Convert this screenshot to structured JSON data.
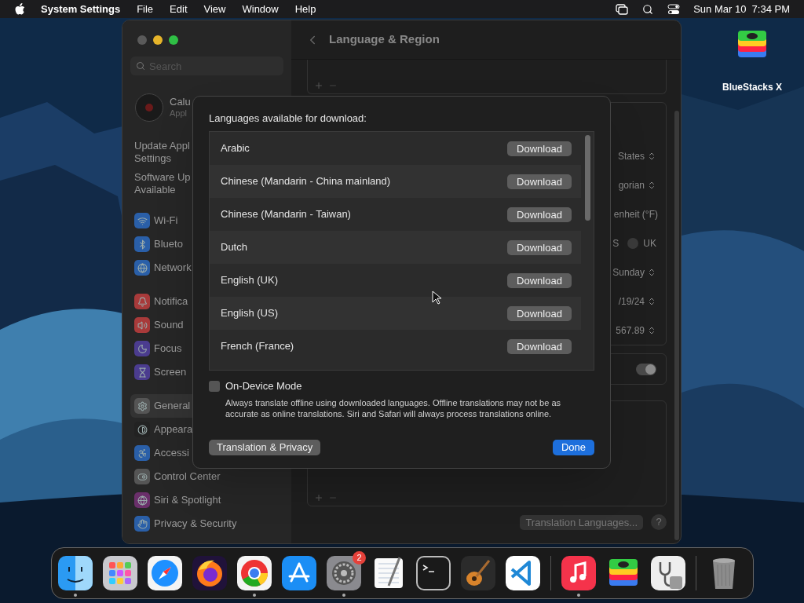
{
  "menu_bar": {
    "app": "System Settings",
    "menus": [
      "File",
      "Edit",
      "View",
      "Window",
      "Help"
    ],
    "clock": "Sun Mar 10  7:34 PM"
  },
  "desktop_icons": [
    {
      "label": "BlueStacks X"
    }
  ],
  "window": {
    "sidebar": {
      "search": {
        "placeholder": "Search"
      },
      "account": {
        "name": "Calu",
        "subtitle": "Appl"
      },
      "notices": [
        {
          "lines": [
            "Update Appl",
            "Settings"
          ]
        },
        {
          "lines": [
            "Software Up",
            "Available"
          ]
        }
      ],
      "groups": [
        [
          {
            "label": "Wi-Fi",
            "selected": false
          },
          {
            "label": "Blueto",
            "selected": false
          },
          {
            "label": "Network",
            "selected": false
          }
        ],
        [
          {
            "label": "Notifica",
            "selected": false
          },
          {
            "label": "Sound",
            "selected": false
          },
          {
            "label": "Focus",
            "selected": false
          },
          {
            "label": "Screen",
            "selected": false
          }
        ],
        [
          {
            "label": "General",
            "selected": true
          },
          {
            "label": "Appeara",
            "selected": false
          },
          {
            "label": "Accessi",
            "selected": false
          },
          {
            "label": "Control Center",
            "selected": false
          },
          {
            "label": "Siri & Spotlight",
            "selected": false
          },
          {
            "label": "Privacy & Security",
            "selected": false
          }
        ]
      ]
    },
    "content": {
      "title": "Language & Region",
      "rows": [
        {
          "kind": "popup",
          "value": "States"
        },
        {
          "kind": "popup",
          "value": "gorian"
        },
        {
          "kind": "text",
          "value": "enheit (°F)"
        },
        {
          "kind": "radio",
          "value": "S",
          "option": {
            "label": "UK",
            "selected": false
          }
        },
        {
          "kind": "popup",
          "value": "Sunday"
        },
        {
          "kind": "popup",
          "value": "/19/24"
        },
        {
          "kind": "popup",
          "value": "567.89"
        }
      ],
      "toggle": {
        "on": true
      },
      "buttons": [
        "Translation Languages...",
        "?"
      ]
    }
  },
  "sheet": {
    "heading": "Languages available for download:",
    "languages": [
      {
        "name": "Arabic",
        "button": "Download"
      },
      {
        "name": "Chinese (Mandarin - China mainland)",
        "button": "Download"
      },
      {
        "name": "Chinese (Mandarin - Taiwan)",
        "button": "Download"
      },
      {
        "name": "Dutch",
        "button": "Download"
      },
      {
        "name": "English (UK)",
        "button": "Download"
      },
      {
        "name": "English (US)",
        "button": "Download"
      },
      {
        "name": "French (France)",
        "button": "Download"
      }
    ],
    "option": {
      "label": "On-Device Mode",
      "checked": false,
      "description": "Always translate offline using downloaded languages. Offline translations may not be as accurate as online translations. Siri and Safari will always process translations online."
    },
    "secondary_button": "Translation & Privacy",
    "primary_button": "Done"
  },
  "dock": [
    {
      "kind": "finder",
      "running": true
    },
    {
      "kind": "launchpad",
      "running": false
    },
    {
      "kind": "safari",
      "running": false
    },
    {
      "kind": "firefox",
      "running": false
    },
    {
      "kind": "chrome",
      "running": true
    },
    {
      "kind": "appstore",
      "running": false
    },
    {
      "kind": "settings",
      "running": true,
      "badge": "2"
    },
    {
      "kind": "textedit",
      "running": false
    },
    {
      "kind": "terminal",
      "running": false
    },
    {
      "kind": "guitar",
      "running": false
    },
    {
      "kind": "vscode",
      "running": false
    },
    {
      "kind": "separator"
    },
    {
      "kind": "music",
      "running": true
    },
    {
      "kind": "layers",
      "running": false
    },
    {
      "kind": "diskutility",
      "running": false
    },
    {
      "kind": "separator"
    },
    {
      "kind": "trash",
      "running": false
    }
  ]
}
